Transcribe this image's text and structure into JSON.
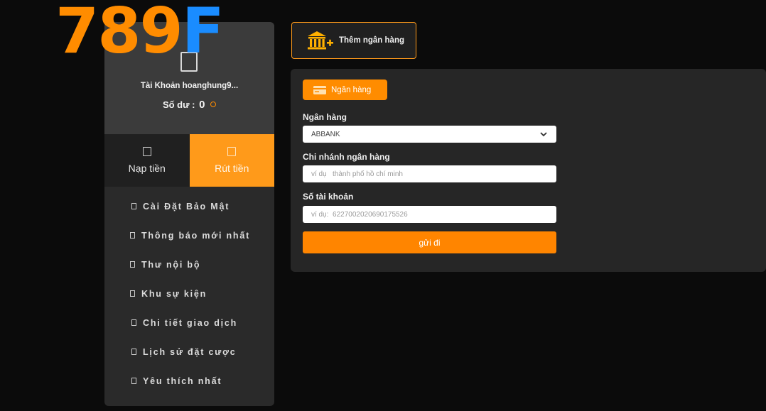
{
  "logo": {
    "number": "789",
    "letter": "F"
  },
  "profile": {
    "account_label": "Tài Khoản hoanghung9...",
    "balance_label": "Số dư :",
    "balance_value": "0"
  },
  "tabs": {
    "deposit": "Nạp tiền",
    "withdraw": "Rút tiền",
    "active": "withdraw"
  },
  "menu": [
    {
      "label": "Cài Đặt Bảo Mật"
    },
    {
      "label": "Thông báo mới nhất"
    },
    {
      "label": "Thư nội bộ"
    },
    {
      "label": "Khu sự kiện"
    },
    {
      "label": "Chi tiết giao dịch"
    },
    {
      "label": "Lịch sử đặt cược"
    },
    {
      "label": "Yêu thích nhất"
    }
  ],
  "add_bank": {
    "label": "Thêm ngân hàng",
    "icon": "bank-plus-icon"
  },
  "form": {
    "tab_label": "Ngân hàng",
    "bank_label": "Ngân hàng",
    "bank_value": "ABBANK",
    "branch_label": "Chi nhánh ngân hàng",
    "branch_placeholder": "ví dụ   thành phố hồ chí minh",
    "account_label": "Số tài khoản",
    "account_placeholder": "ví dụ:  6227002020690175526",
    "submit_label": "gửi đi"
  },
  "colors": {
    "accent": "#ff8c00",
    "logo_letter": "#1a8cff",
    "bg": "#0b0b0b",
    "panel": "#262626"
  }
}
